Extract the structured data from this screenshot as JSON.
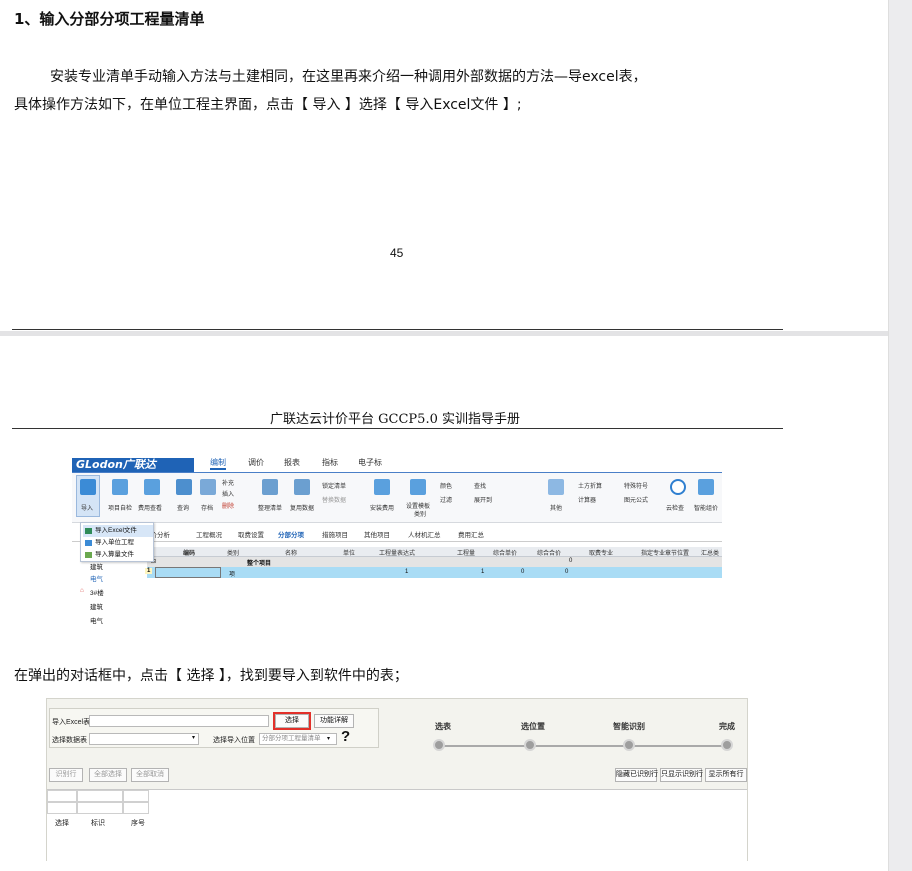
{
  "page1": {
    "heading": "1、输入分部分项工程量清单",
    "para_line1": "安装专业清单手动输入方法与土建相同，在这里再来介绍一种调用外部数据的方法—导excel表，",
    "para_line2": "具体操作方法如下，在单位工程主界面，点击【 导入 】选择【 导入Excel文件 】;",
    "page_number": "45"
  },
  "page2": {
    "running_header": "广联达云计价平台 GCCP5.0 实训指导手册",
    "para_dialog": "在弹出的对话框中，点击【 选择 】，找到要导入到软件中的表；"
  },
  "screenshot1": {
    "logo": "GLodon广联达",
    "menus": [
      "编制",
      "调价",
      "报表",
      "指标",
      "电子标"
    ],
    "ribbon": [
      {
        "label": "导入",
        "icon": "import-icon"
      },
      {
        "label": "项目自检",
        "icon": "check-icon"
      },
      {
        "label": "费用查看",
        "icon": "view-icon"
      },
      {
        "label": "查询",
        "icon": "query-icon"
      },
      {
        "label": "存档",
        "icon": "save-icon"
      },
      {
        "label": "补充",
        "icon": "add-icon"
      },
      {
        "label": "插入",
        "icon": "insert-icon"
      },
      {
        "label": "删除",
        "icon": "delete-icon"
      },
      {
        "label": "整理清单",
        "icon": "organize-icon"
      },
      {
        "label": "复用数据",
        "icon": "reuse-icon"
      },
      {
        "label": "锁定清单",
        "icon": "lock-icon"
      },
      {
        "label": "替换数据",
        "icon": "replace-icon"
      },
      {
        "label": "安装费用",
        "icon": "install-fee-icon"
      },
      {
        "label": "设置模板",
        "icon": "template-icon"
      },
      {
        "label": "类别",
        "icon": ""
      },
      {
        "label": "颜色",
        "icon": "color-icon"
      },
      {
        "label": "查找",
        "icon": "find-icon"
      },
      {
        "label": "过滤",
        "icon": "filter-icon"
      },
      {
        "label": "展开到",
        "icon": "expand-icon"
      },
      {
        "label": "其他",
        "icon": "other-icon"
      },
      {
        "label": "土方折算",
        "icon": "earth-icon"
      },
      {
        "label": "特殊符号",
        "icon": "symbol-icon"
      },
      {
        "label": "计算器",
        "icon": "calculator-icon"
      },
      {
        "label": "图元公式",
        "icon": "formula-icon"
      },
      {
        "label": "云检查",
        "icon": "cloud-check-icon"
      },
      {
        "label": "智能组价",
        "icon": "smart-price-icon"
      }
    ],
    "tabs": [
      "造价分析",
      "工程概况",
      "取费设置",
      "分部分项",
      "措施项目",
      "其他项目",
      "人材机汇总",
      "费用汇总"
    ],
    "dropdown": [
      "导入Excel文件",
      "导入单位工程",
      "导入算量文件"
    ],
    "tree": [
      "建筑",
      "电气",
      "3#楼",
      "建筑",
      "电气"
    ],
    "columns": [
      "编码",
      "类别",
      "名称",
      "单位",
      "工程量表达式",
      "工程量",
      "综合单价",
      "综合合价",
      "取费专业",
      "指定专业章节位置",
      "汇总类"
    ],
    "row_total": {
      "name": "整个项目",
      "sum": "0"
    },
    "row1": {
      "no": "1",
      "type": "项",
      "expr": "1",
      "qty": "1",
      "price": "0",
      "sum": "0"
    }
  },
  "screenshot2": {
    "import_excel_label": "导入Excel表",
    "select_sheet_label": "选择数据表",
    "select_btn": "选择",
    "help_btn": "功能详解",
    "import_pos_label": "选择导入位置",
    "import_pos_value": "分部分项工程量清单",
    "question": "?",
    "steps": [
      "选表",
      "选位置",
      "智能识别",
      "完成"
    ],
    "left_buttons": [
      "识别行",
      "全部选择",
      "全部取消"
    ],
    "right_buttons": [
      "隐藏已识别行",
      "只显示识别行",
      "显示所有行"
    ],
    "col_headers": [
      "选择",
      "标识",
      "序号"
    ]
  }
}
